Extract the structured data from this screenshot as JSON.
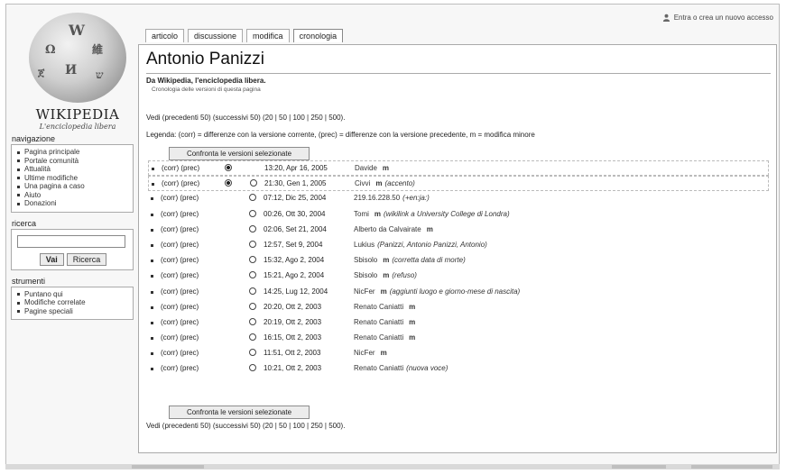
{
  "logo": {
    "wordmark": "WIKIPEDIA",
    "tagline": "L'enciclopedia libera",
    "glyphs": [
      "W",
      "Ω",
      "維",
      "И",
      "ጀ",
      "ש"
    ]
  },
  "user_link": "Entra o crea un nuovo accesso",
  "tabs": [
    "articolo",
    "discussione",
    "modifica",
    "cronologia"
  ],
  "active_tab": "cronologia",
  "sidebar": {
    "nav_title": "navigazione",
    "nav_items": [
      "Pagina principale",
      "Portale comunità",
      "Attualità",
      "Ultime modifiche",
      "Una pagina a caso",
      "Aiuto",
      "Donazioni"
    ],
    "search_title": "ricerca",
    "search_go": "Vai",
    "search_search": "Ricerca",
    "tools_title": "strumenti",
    "tools_items": [
      "Puntano qui",
      "Modifiche correlate",
      "Pagine speciali"
    ]
  },
  "content": {
    "title": "Antonio Panizzi",
    "site_sub": "Da Wikipedia, l'enciclopedia libera.",
    "content_sub": "Cronologia delle versioni di questa pagina",
    "nav_line": "Vedi (precedenti 50) (successivi 50) (20 | 50 | 100 | 250 | 500).",
    "legend": "Legenda: (corr) = differenze con la versione corrente, (prec) = differenze con la versione precedente, m = modifica minore",
    "compare_button": "Confronta le versioni selezionate",
    "minor_flag": "m"
  },
  "history": [
    {
      "links": "(corr) (prec)",
      "date": "13:20, Apr 16, 2005",
      "user": "Davide",
      "minor": true,
      "comment": "",
      "r1": "on",
      "r2": "none"
    },
    {
      "links": "(corr) (prec)",
      "date": "21:30, Gen 1, 2005",
      "user": "Civvi",
      "minor": true,
      "comment": "(accento)",
      "r1": "on",
      "r2": "off"
    },
    {
      "links": "(corr) (prec)",
      "date": "07:12, Dic 25, 2004",
      "user": "219.16.228.50",
      "minor": false,
      "comment": "(+en:ja:)",
      "r1": "none",
      "r2": "off"
    },
    {
      "links": "(corr) (prec)",
      "date": "00:26, Ott 30, 2004",
      "user": "Tomi",
      "minor": true,
      "comment": "(wikilink a University College di Londra)",
      "r1": "none",
      "r2": "off"
    },
    {
      "links": "(corr) (prec)",
      "date": "02:06, Set 21, 2004",
      "user": "Alberto da Calvairate",
      "minor": true,
      "comment": "",
      "r1": "none",
      "r2": "off"
    },
    {
      "links": "(corr) (prec)",
      "date": "12:57, Set 9, 2004",
      "user": "Lukius",
      "minor": false,
      "comment": "(Panizzi, Antonio Panizzi, Antonio)",
      "r1": "none",
      "r2": "off"
    },
    {
      "links": "(corr) (prec)",
      "date": "15:32, Ago 2, 2004",
      "user": "Sbisolo",
      "minor": true,
      "comment": "(corretta data di morte)",
      "r1": "none",
      "r2": "off"
    },
    {
      "links": "(corr) (prec)",
      "date": "15:21, Ago 2, 2004",
      "user": "Sbisolo",
      "minor": true,
      "comment": "(refuso)",
      "r1": "none",
      "r2": "off"
    },
    {
      "links": "(corr) (prec)",
      "date": "14:25, Lug 12, 2004",
      "user": "NicFer",
      "minor": true,
      "comment": "(aggiunti luogo e giorno-mese di nascita)",
      "r1": "none",
      "r2": "off"
    },
    {
      "links": "(corr) (prec)",
      "date": "20:20, Ott 2, 2003",
      "user": "Renato Caniatti",
      "minor": true,
      "comment": "",
      "r1": "none",
      "r2": "off"
    },
    {
      "links": "(corr) (prec)",
      "date": "20:19, Ott 2, 2003",
      "user": "Renato Caniatti",
      "minor": true,
      "comment": "",
      "r1": "none",
      "r2": "off"
    },
    {
      "links": "(corr) (prec)",
      "date": "16:15, Ott 2, 2003",
      "user": "Renato Caniatti",
      "minor": true,
      "comment": "",
      "r1": "none",
      "r2": "off"
    },
    {
      "links": "(corr) (prec)",
      "date": "11:51, Ott 2, 2003",
      "user": "NicFer",
      "minor": true,
      "comment": "",
      "r1": "none",
      "r2": "off"
    },
    {
      "links": "(corr) (prec)",
      "date": "10:21, Ott 2, 2003",
      "user": "Renato Caniatti",
      "minor": false,
      "comment": "(nuova voce)",
      "r1": "none",
      "r2": "off"
    }
  ]
}
